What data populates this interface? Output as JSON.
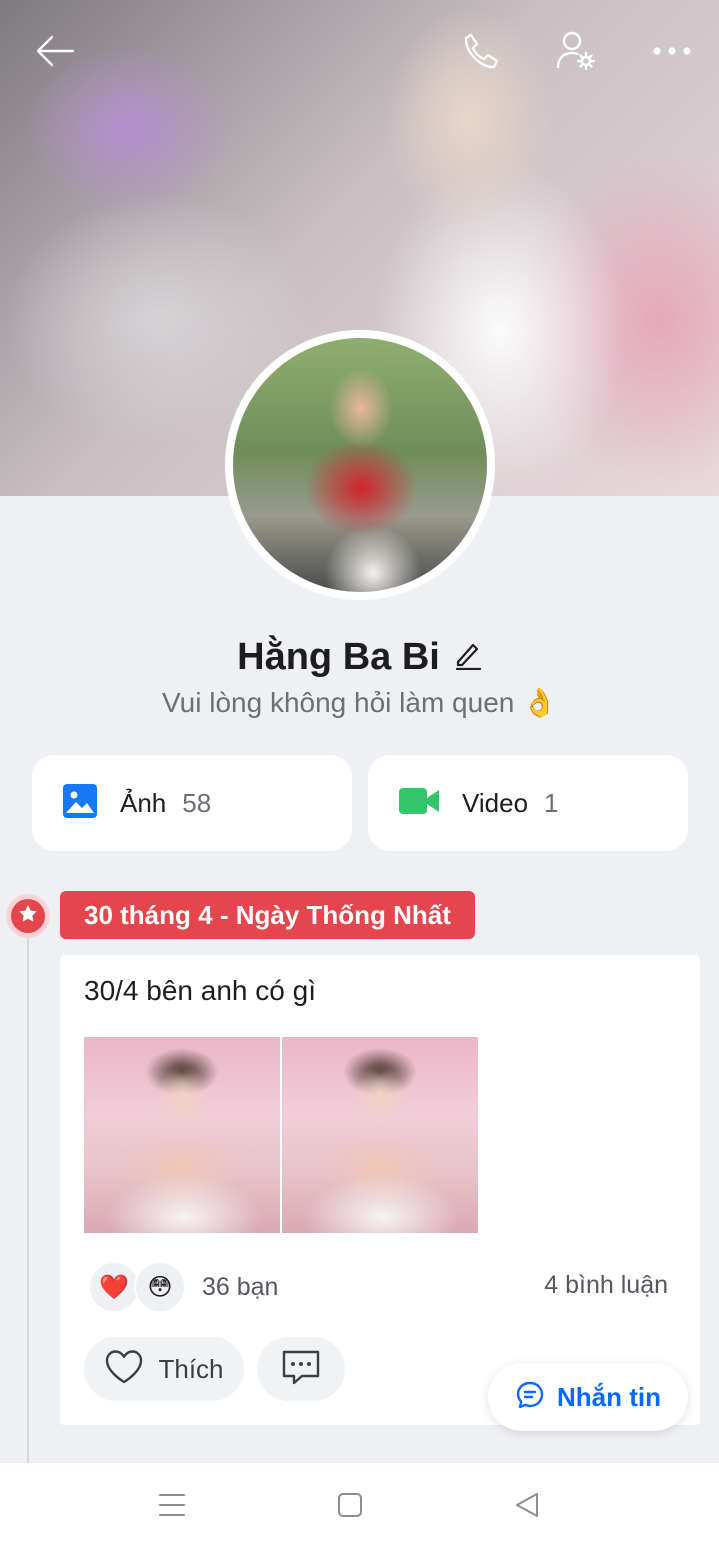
{
  "header": {
    "back_icon": "arrow-left-icon",
    "call_icon": "phone-icon",
    "user_settings_icon": "user-gear-icon",
    "more_icon": "more-horizontal-icon"
  },
  "profile": {
    "name": "Hằng Ba Bi",
    "bio": "Vui lòng không hỏi làm quen 👌"
  },
  "media": {
    "photos_label": "Ảnh",
    "photos_count": "58",
    "videos_label": "Video",
    "videos_count": "1"
  },
  "timeline": {
    "event_tag": "30 tháng 4 - Ngày Thống Nhất",
    "post": {
      "text": "30/4 bên anh có gì",
      "reaction_1": "❤️",
      "reaction_2": "😳",
      "reactions_count": "36 bạn",
      "comments_count": "4 bình luận",
      "like_label": "Thích"
    }
  },
  "fab": {
    "message_label": "Nhắn tin"
  },
  "colors": {
    "accent_blue": "#0a68ff",
    "event_red": "#e5454d",
    "photo_icon_blue": "#1877f2",
    "video_icon_green": "#34c46a"
  }
}
